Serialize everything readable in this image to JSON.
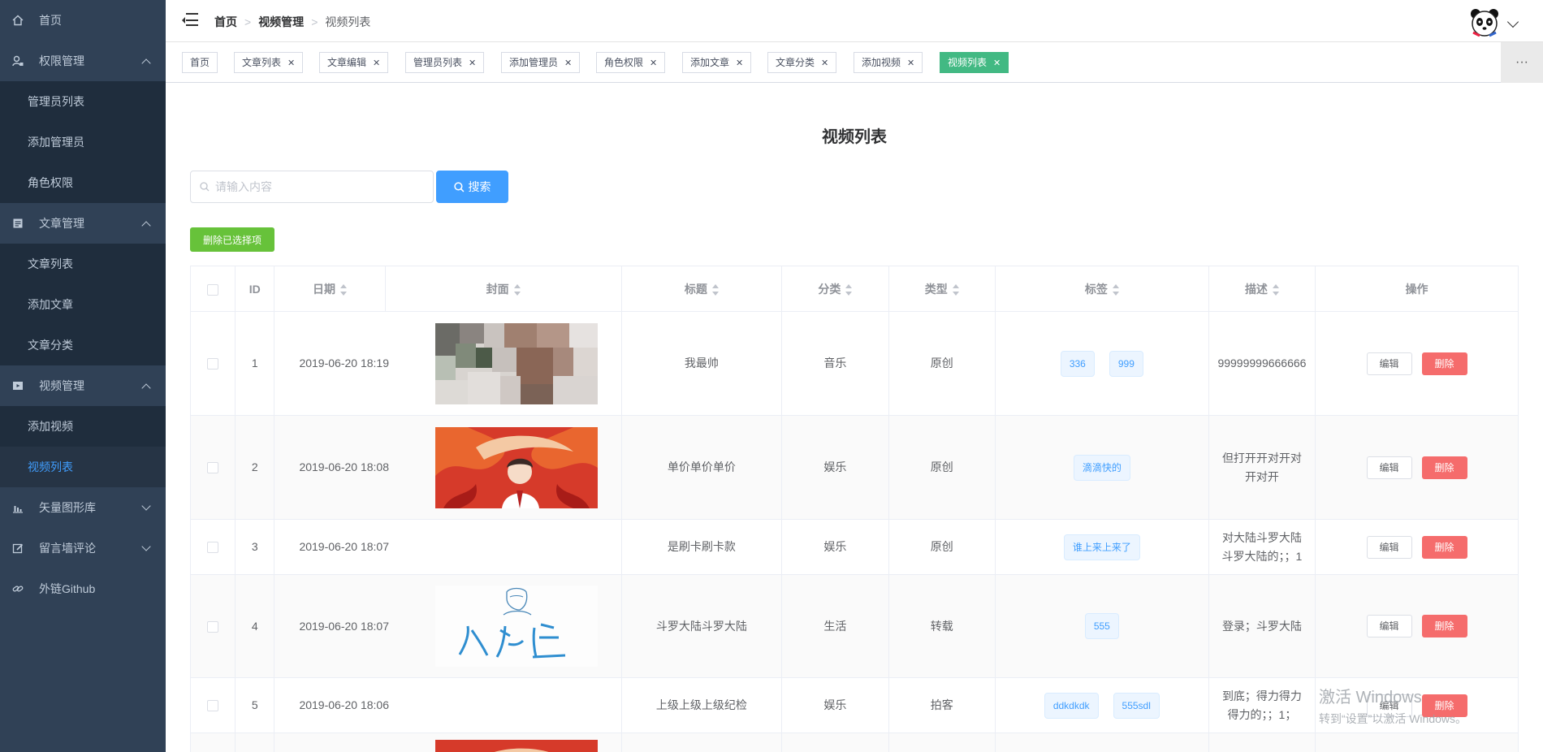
{
  "sidebar": {
    "items": [
      {
        "label": "首页",
        "icon": "home-icon"
      },
      {
        "label": "权限管理",
        "icon": "user-lock-icon",
        "expanded": true,
        "children": [
          "管理员列表",
          "添加管理员",
          "角色权限"
        ]
      },
      {
        "label": "文章管理",
        "icon": "document-icon",
        "expanded": true,
        "children": [
          "文章列表",
          "添加文章",
          "文章分类"
        ]
      },
      {
        "label": "视频管理",
        "icon": "video-icon",
        "expanded": true,
        "children": [
          "添加视频",
          "视频列表"
        ]
      },
      {
        "label": "矢量图形库",
        "icon": "chart-bar-icon",
        "expanded": false
      },
      {
        "label": "留言墙评论",
        "icon": "edit-icon",
        "expanded": false
      },
      {
        "label": "外链Github",
        "icon": "link-icon"
      }
    ],
    "active": "视频列表",
    "colors": {
      "bg": "#304156",
      "active_text": "#409eff"
    }
  },
  "header": {
    "breadcrumb": [
      "首页",
      "视频管理",
      "视频列表"
    ]
  },
  "tags": [
    {
      "label": "首页",
      "closable": false
    },
    {
      "label": "文章列表",
      "closable": true
    },
    {
      "label": "文章编辑",
      "closable": true
    },
    {
      "label": "管理员列表",
      "closable": true
    },
    {
      "label": "添加管理员",
      "closable": true
    },
    {
      "label": "角色权限",
      "closable": true
    },
    {
      "label": "添加文章",
      "closable": true
    },
    {
      "label": "文章分类",
      "closable": true
    },
    {
      "label": "添加视频",
      "closable": true
    },
    {
      "label": "视频列表",
      "closable": true,
      "active": true
    }
  ],
  "tags_more": "···",
  "main": {
    "title": "视频列表",
    "search_placeholder": "请输入内容",
    "search_button": "搜索",
    "delete_selected": "删除已选择项"
  },
  "table": {
    "columns": [
      "ID",
      "日期",
      "封面",
      "标题",
      "分类",
      "类型",
      "标签",
      "描述",
      "操作"
    ],
    "edit_label": "编辑",
    "delete_label": "删除",
    "rows": [
      {
        "id": "1",
        "date": "2019-06-20 18:19",
        "cover": "blurred-photo",
        "title": "我最帅",
        "category": "音乐",
        "type": "原创",
        "tags": [
          "336",
          "999"
        ],
        "desc": "99999999666666"
      },
      {
        "id": "2",
        "date": "2019-06-20 18:08",
        "cover": "anime-red",
        "title": "单价单价单价",
        "category": "娱乐",
        "type": "原创",
        "tags": [
          "滴滴快的"
        ],
        "desc": "但打开开对开对开对开"
      },
      {
        "id": "3",
        "date": "2019-06-20 18:07",
        "cover": "",
        "title": "是刷卡刷卡款",
        "category": "娱乐",
        "type": "原创",
        "tags": [
          "谁上来上来了"
        ],
        "desc": "对大陆斗罗大陆斗罗大陆的；；1"
      },
      {
        "id": "4",
        "date": "2019-06-20 18:07",
        "cover": "sketch-logo",
        "title": "斗罗大陆斗罗大陆",
        "category": "生活",
        "type": "转载",
        "tags": [
          "555"
        ],
        "desc": "登录；斗罗大陆"
      },
      {
        "id": "5",
        "date": "2019-06-20 18:06",
        "cover": "",
        "title": "上级上级上级纪检",
        "category": "娱乐",
        "type": "拍客",
        "tags": [
          "ddkdkdk",
          "555sdl"
        ],
        "desc": "到底；得力得力得力的；；1；"
      }
    ]
  },
  "watermark": {
    "line1": "激活 Windows",
    "line2": "转到“设置”以激活 Windows。"
  }
}
